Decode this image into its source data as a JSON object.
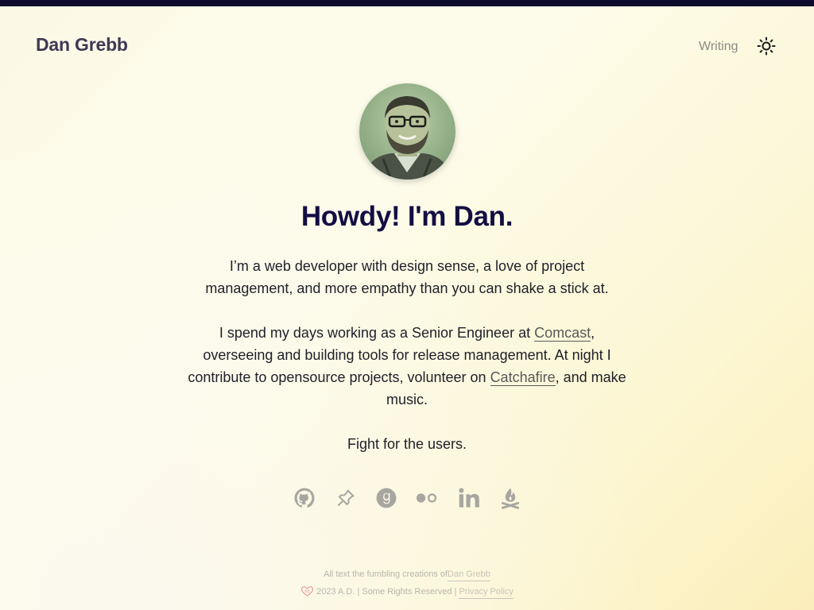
{
  "header": {
    "site_title": "Dan Grebb",
    "nav_writing": "Writing",
    "theme_icon": "sun-icon"
  },
  "hero": {
    "title": "Howdy! I'm Dan.",
    "bio_1": "I’m a web developer with design sense, a love of project management, and more empathy than you can shake a stick at.",
    "bio_2_before": "I spend my days working as a Senior Engineer at ",
    "bio_2_link1": "Comcast",
    "bio_2_mid": ", overseeing and building tools for release management. At night I contribute to opensource projects, volunteer on ",
    "bio_2_link2": "Catchafire",
    "bio_2_after": ", and make music.",
    "bio_3": "Fight for the users."
  },
  "social": [
    {
      "icon": "github-icon"
    },
    {
      "icon": "pinboard-icon"
    },
    {
      "icon": "goodreads-icon"
    },
    {
      "icon": "flickr-icon"
    },
    {
      "icon": "linkedin-icon"
    },
    {
      "icon": "campfire-icon"
    }
  ],
  "footer": {
    "line1_text": "All text the fumbling creations of",
    "line1_link": "Dan Grebb",
    "line2_text": "2023 A.D. | Some Rights Reserved | ",
    "line2_link": "Privacy Policy"
  },
  "colors": {
    "topbar": "#0d0a2b",
    "title": "#130e42",
    "icon_gray": "#a8a6a0"
  }
}
